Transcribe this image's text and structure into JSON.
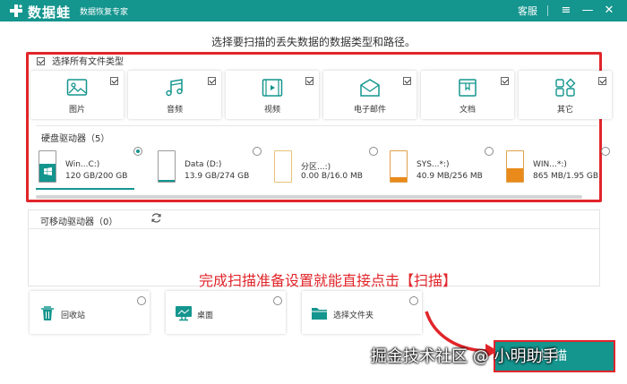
{
  "app": {
    "name": "数据蛙",
    "tagline": "数据恢复专家",
    "service_label": "客服",
    "brand_color": "#14958e",
    "accent_red": "#e1252a"
  },
  "heading": "选择要扫描的丢失数据的数据类型和路径。",
  "select_all_label": "选择所有文件类型",
  "file_types": [
    {
      "label": "图片",
      "icon": "image-icon",
      "checked": true
    },
    {
      "label": "音频",
      "icon": "music-icon",
      "checked": true
    },
    {
      "label": "视频",
      "icon": "video-icon",
      "checked": true
    },
    {
      "label": "电子邮件",
      "icon": "email-icon",
      "checked": true
    },
    {
      "label": "文档",
      "icon": "document-icon",
      "checked": true
    },
    {
      "label": "其它",
      "icon": "other-icon",
      "checked": true
    }
  ],
  "hard_drives": {
    "title": "硬盘驱动器（5）",
    "items": [
      {
        "name": "Win...C:)",
        "size": "120 GB/200 GB",
        "usage": 0.6,
        "fill_color": "#14958e",
        "selected": true
      },
      {
        "name": "Data (D:)",
        "size": "13.9 GB/274 GB",
        "usage": 0.05,
        "fill_color": "#14958e",
        "selected": false
      },
      {
        "name": "分区...:)",
        "size": "0.00  B/16.0 MB",
        "usage": 0.0,
        "fill_color": "#e9a23b",
        "selected": false
      },
      {
        "name": "SYS...*:)",
        "size": "40.9 MB/256 MB",
        "usage": 0.16,
        "fill_color": "#e98a1a",
        "selected": false
      },
      {
        "name": "WIN...*:)",
        "size": "865 MB/1.95 GB",
        "usage": 0.43,
        "fill_color": "#e98a1a",
        "selected": false
      }
    ]
  },
  "removable": {
    "title": "可移动驱动器（0）"
  },
  "annotation": "完成扫描准备设置就能直接点击【扫描】",
  "locations": [
    {
      "label": "回收站",
      "icon": "trash-icon"
    },
    {
      "label": "桌面",
      "icon": "desktop-icon"
    },
    {
      "label": "选择文件夹",
      "icon": "folder-icon"
    }
  ],
  "watermark": "掘金技术社区 @ 小明助手",
  "scan_button_label": "扫描"
}
